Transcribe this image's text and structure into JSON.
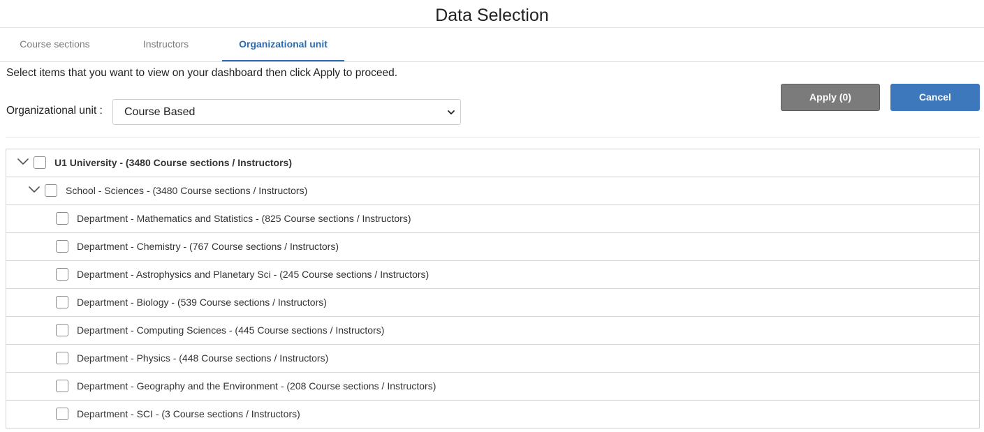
{
  "header": {
    "title": "Data Selection"
  },
  "tabs": [
    {
      "label": "Course sections",
      "active": false
    },
    {
      "label": "Instructors",
      "active": false
    },
    {
      "label": "Organizational unit",
      "active": true
    }
  ],
  "instructions": "Select items that you want to view on your dashboard then click Apply to proceed.",
  "filter": {
    "label": "Organizational unit :",
    "selected": "Course Based",
    "icon": "chevron-down-icon"
  },
  "buttons": {
    "apply": "Apply (0)",
    "cancel": "Cancel"
  },
  "colors": {
    "accent": "#2b6cb0",
    "apply_bg": "#7b7b7b",
    "cancel_bg": "#3d78bd"
  },
  "tree": [
    {
      "label": "U1 University - (3480 Course sections / Instructors)",
      "level": 0,
      "expanded": true,
      "checked": false
    },
    {
      "label": "School - Sciences - (3480 Course sections / Instructors)",
      "level": 1,
      "expanded": true,
      "checked": false
    },
    {
      "label": "Department - Mathematics and Statistics - (825 Course sections / Instructors)",
      "level": 2,
      "checked": false
    },
    {
      "label": "Department - Chemistry - (767 Course sections / Instructors)",
      "level": 2,
      "checked": false
    },
    {
      "label": "Department - Astrophysics and Planetary Sci - (245 Course sections / Instructors)",
      "level": 2,
      "checked": false
    },
    {
      "label": "Department - Biology - (539 Course sections / Instructors)",
      "level": 2,
      "checked": false
    },
    {
      "label": "Department - Computing Sciences - (445 Course sections / Instructors)",
      "level": 2,
      "checked": false
    },
    {
      "label": "Department - Physics - (448 Course sections / Instructors)",
      "level": 2,
      "checked": false
    },
    {
      "label": "Department - Geography and the Environment - (208 Course sections / Instructors)",
      "level": 2,
      "checked": false
    },
    {
      "label": "Department - SCI - (3 Course sections / Instructors)",
      "level": 2,
      "checked": false
    }
  ]
}
